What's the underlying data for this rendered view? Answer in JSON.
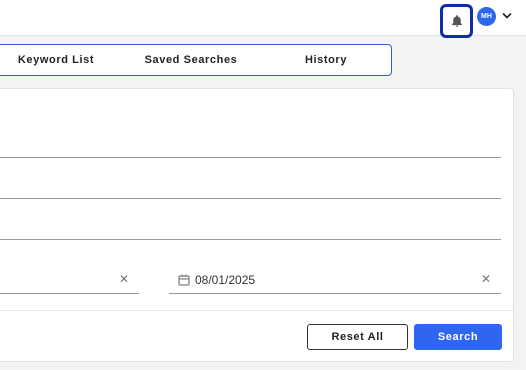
{
  "header": {
    "notifications_icon": "bell-icon",
    "avatar_initials": "MH",
    "avatar_menu_icon": "chevron-down-icon",
    "avatar_color": "#2f66f0",
    "focus_ring_color": "#0a2fa8"
  },
  "tabs": [
    {
      "label": "Keyword List"
    },
    {
      "label": "Saved Searches"
    },
    {
      "label": "History"
    }
  ],
  "form": {
    "date_from_clear_icon": "close-icon",
    "date_to": {
      "icon": "calendar-icon",
      "value": "08/01/2025",
      "clear_icon": "close-icon"
    }
  },
  "actions": {
    "reset_label": "Reset All",
    "search_label": "Search",
    "primary_color": "#2f66f0"
  }
}
